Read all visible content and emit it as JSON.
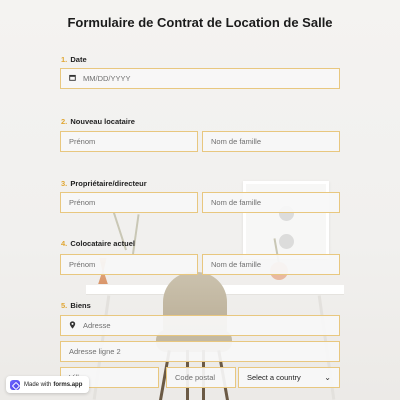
{
  "form": {
    "title": "Formulaire de Contrat de Location de Salle",
    "questions": [
      {
        "number": "1.",
        "label": "Date",
        "date_placeholder": "MM/DD/YYYY"
      },
      {
        "number": "2.",
        "label": "Nouveau locataire",
        "first_placeholder": "Prénom",
        "last_placeholder": "Nom de famille"
      },
      {
        "number": "3.",
        "label": "Propriétaire/directeur",
        "first_placeholder": "Prénom",
        "last_placeholder": "Nom de famille"
      },
      {
        "number": "4.",
        "label": "Colocataire actuel",
        "first_placeholder": "Prénom",
        "last_placeholder": "Nom de famille"
      },
      {
        "number": "5.",
        "label": "Biens",
        "address_placeholder": "Adresse",
        "address2_placeholder": "Adresse ligne 2",
        "city_placeholder": "Ville",
        "postal_placeholder": "Code postal",
        "country_placeholder": "Select a country"
      }
    ]
  },
  "badge": {
    "prefix": "Made with",
    "brand": "forms.app"
  },
  "icons": {
    "calendar": "calendar-icon",
    "location": "location-pin-icon",
    "dropdown": "chevron-down-icon"
  },
  "colors": {
    "accent": "#e0a632",
    "field_border": "#e8c77f",
    "brand": "#5b52f0"
  }
}
